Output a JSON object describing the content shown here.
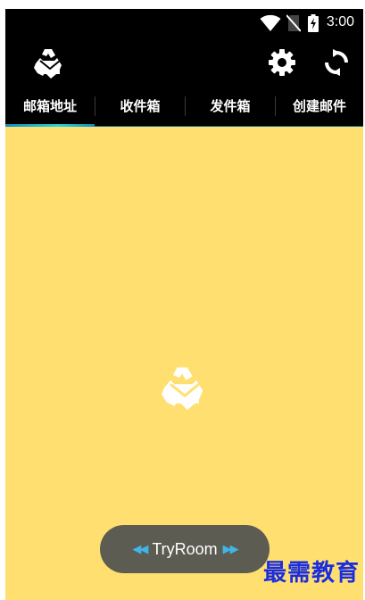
{
  "status_bar": {
    "time": "3:00",
    "icons": [
      "wifi-icon",
      "no-sim-icon",
      "battery-charging-icon"
    ]
  },
  "action_bar": {
    "logo_icon": "recycle-mail-icon",
    "actions": [
      "gear-icon",
      "refresh-icon"
    ]
  },
  "tabs": [
    {
      "label": "邮箱地址",
      "selected": true
    },
    {
      "label": "收件箱",
      "selected": false
    },
    {
      "label": "发件箱",
      "selected": false
    },
    {
      "label": "创建邮件",
      "selected": false
    }
  ],
  "content": {
    "background_color": "#ffdf70",
    "center_icon": "recycle-mail-icon"
  },
  "toast": {
    "text": "TryRoom",
    "left_arrow": "◀◀",
    "right_arrow": "▶▶"
  },
  "watermark": "最需教育"
}
